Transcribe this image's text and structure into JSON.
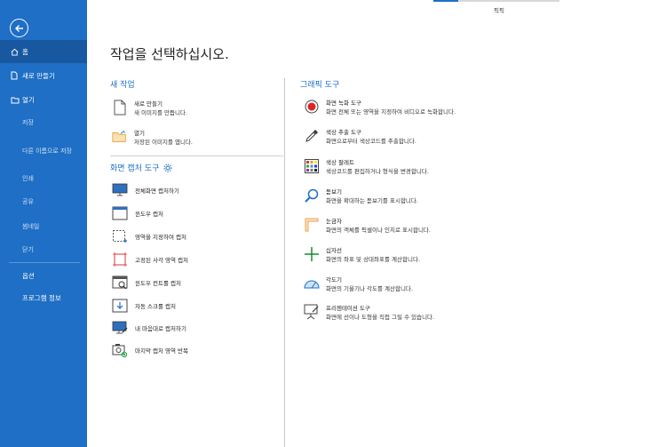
{
  "sidebar": {
    "back_icon": "back-arrow-icon",
    "items": [
      {
        "label": "홈",
        "icon": "home-icon"
      },
      {
        "label": "새로 만들기",
        "icon": "new-file-icon"
      },
      {
        "label": "열기",
        "icon": "open-folder-icon"
      },
      {
        "label": "저장"
      },
      {
        "label": "다른 이름으로 저장"
      },
      {
        "label": "인쇄"
      },
      {
        "label": "공유"
      },
      {
        "label": "썸네일"
      },
      {
        "label": "닫기"
      },
      {
        "label": "옵션"
      },
      {
        "label": "프로그램 정보"
      }
    ]
  },
  "topbar": {
    "label": "픽픽"
  },
  "main": {
    "title": "작업을 선택하십시오.",
    "new_task": {
      "title": "새 작업",
      "items": [
        {
          "title": "새로 만들기",
          "desc": "새 이미지를 만듭니다."
        },
        {
          "title": "열기",
          "desc": "저장된 이미지를 엽니다."
        }
      ]
    },
    "capture": {
      "title": "화면 캡처 도구",
      "items": [
        {
          "label": "전체화면 캡처하기",
          "icon": "monitor-icon"
        },
        {
          "label": "윈도우 캡처",
          "icon": "window-icon"
        },
        {
          "label": "영역을 지정하여 캡처",
          "icon": "dashed-region-icon"
        },
        {
          "label": "고정된 사각 영역 캡처",
          "icon": "fixed-rect-icon"
        },
        {
          "label": "윈도우 컨트롤 캡처",
          "icon": "window-control-icon"
        },
        {
          "label": "자동 스크롤 캡처",
          "icon": "scroll-capture-icon"
        },
        {
          "label": "내 마음대로 캡처하기",
          "icon": "freehand-icon"
        },
        {
          "label": "마지막 캡처 영역 반복",
          "icon": "repeat-camera-icon"
        }
      ]
    },
    "graphic": {
      "title": "그래픽 도구",
      "items": [
        {
          "title": "화면 녹화 도구",
          "desc": "화면 전체 또는 영역을 지정하여 비디오로 녹화합니다.",
          "icon": "record-icon"
        },
        {
          "title": "색상 추출 도구",
          "desc": "화면으로부터 색상코드를 추출합니다.",
          "icon": "eyedropper-icon"
        },
        {
          "title": "색상 팔레트",
          "desc": "색상코드를 편집하거나 형식을 변경합니다.",
          "icon": "palette-icon"
        },
        {
          "title": "돋보기",
          "desc": "화면을 확대하는 돋보기를 표시합니다.",
          "icon": "magnifier-icon"
        },
        {
          "title": "눈금자",
          "desc": "화면의 객체를 픽셀이나 인치로 표시합니다.",
          "icon": "ruler-icon"
        },
        {
          "title": "십자선",
          "desc": "화면의 좌표 및 상대좌표를 계산합니다.",
          "icon": "crosshair-icon"
        },
        {
          "title": "각도기",
          "desc": "화면의 기울기나 각도를 계산합니다.",
          "icon": "protractor-icon"
        },
        {
          "title": "프리젠테이션 도구",
          "desc": "화면에 선이나 도형을 직접 그릴 수 있습니다.",
          "icon": "presentation-icon"
        }
      ]
    }
  },
  "colors": {
    "accent": "#1e6fc5",
    "sidebar_active": "#1858a0",
    "record_red": "#e02424",
    "crosshair_green": "#1a8a2e",
    "ruler_orange": "#f0a050"
  }
}
